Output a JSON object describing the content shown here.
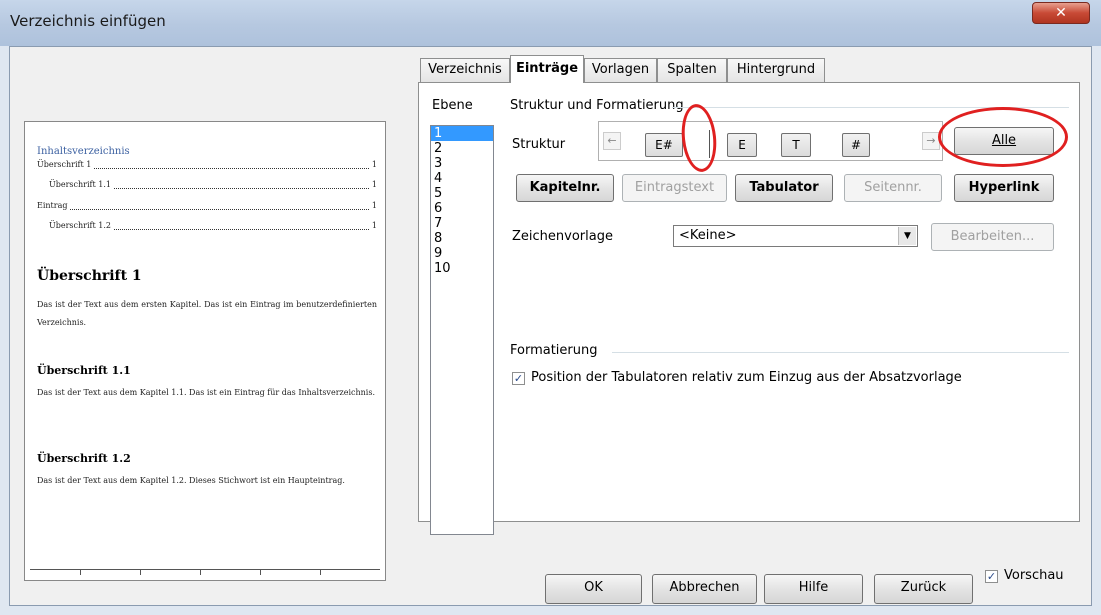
{
  "window": {
    "title": "Verzeichnis einfügen",
    "close_glyph": "✕"
  },
  "tabs": [
    {
      "label": "Verzeichnis"
    },
    {
      "label": "Einträge"
    },
    {
      "label": "Vorlagen"
    },
    {
      "label": "Spalten"
    },
    {
      "label": "Hintergrund"
    }
  ],
  "level": {
    "label": "Ebene",
    "items": [
      "1",
      "2",
      "3",
      "4",
      "5",
      "6",
      "7",
      "8",
      "9",
      "10"
    ],
    "selected": "1"
  },
  "structure": {
    "group_title": "Struktur und Formatierung",
    "label": "Struktur",
    "tokens": [
      "E#",
      "E",
      "T",
      "#"
    ],
    "left_arrow": "←",
    "right_arrow": "→",
    "all_button": "Alle"
  },
  "entry_buttons": {
    "chapter_no": "Kapitelnr.",
    "entry_text": "Eintragstext",
    "tab": "Tabulator",
    "page_no": "Seitennr.",
    "hyperlink": "Hyperlink"
  },
  "char_style": {
    "label": "Zeichenvorlage",
    "value": "<Keine>",
    "edit_button": "Bearbeiten..."
  },
  "formatting": {
    "group_title": "Formatierung",
    "checkbox_label": "Position der Tabulatoren relativ zum Einzug aus der Absatzvorlage",
    "checked": true
  },
  "preview": {
    "toc_title": "Inhaltsverzeichnis",
    "toc_entries": [
      {
        "text": "Überschrift 1",
        "page": "1"
      },
      {
        "text": "Überschrift 1.1",
        "page": "1"
      },
      {
        "text": "Eintrag",
        "page": "1"
      },
      {
        "text": "Überschrift 1.2",
        "page": "1"
      }
    ],
    "heading1": "Überschrift 1",
    "para1": "Das ist der Text aus dem ersten Kapitel. Das ist ein Eintrag im benutzerdefinierten Verzeichnis.",
    "heading2": "Überschrift 1.1",
    "para2": "Das ist der Text aus dem Kapitel 1.1. Das ist ein Eintrag für das Inhaltsverzeichnis.",
    "heading3": "Überschrift 1.2",
    "para3": "Das ist der Text aus dem Kapitel 1.2. Dieses Stichwort ist ein Haupteintrag."
  },
  "footer": {
    "ok": "OK",
    "cancel": "Abbrechen",
    "help": "Hilfe",
    "back": "Zurück",
    "preview_label": "Vorschau",
    "preview_checked": true
  },
  "colors": {
    "annotation_red": "#e02020",
    "selection": "#3399ff"
  }
}
